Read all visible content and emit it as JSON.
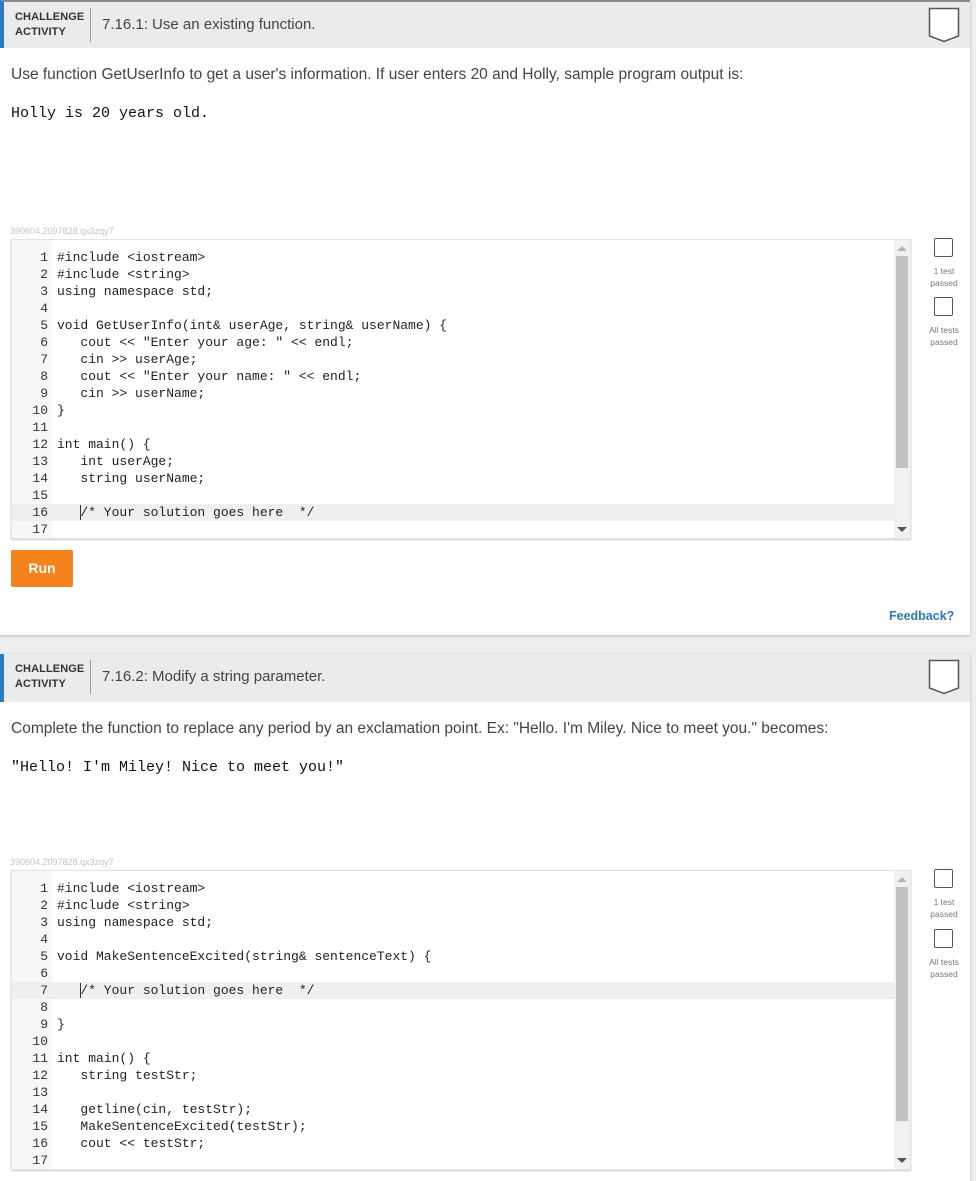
{
  "colors": {
    "accent": "#2c7bc4",
    "run": "#f4831e",
    "link": "#2a7ab8"
  },
  "icons": {
    "bookmark": "bookmark-icon",
    "test_status": "checkbox-outline-icon"
  },
  "challenges": [
    {
      "label_line1": "CHALLENGE",
      "label_line2": "ACTIVITY",
      "title": "7.16.1: Use an existing function.",
      "prompt": "Use function GetUserInfo to get a user's information. If user enters 20 and Holly, sample program output is:",
      "sample_output": "Holly is 20 years old.",
      "code_id": "390604.2097828.qx3zqy7",
      "code_lines": [
        {
          "n": "1",
          "text": "#include <iostream>"
        },
        {
          "n": "2",
          "text": "#include <string>"
        },
        {
          "n": "3",
          "text": "using namespace std;"
        },
        {
          "n": "4",
          "text": ""
        },
        {
          "n": "5",
          "text": "void GetUserInfo(int& userAge, string& userName) {"
        },
        {
          "n": "6",
          "text": "   cout << \"Enter your age: \" << endl;"
        },
        {
          "n": "7",
          "text": "   cin >> userAge;"
        },
        {
          "n": "8",
          "text": "   cout << \"Enter your name: \" << endl;"
        },
        {
          "n": "9",
          "text": "   cin >> userName;"
        },
        {
          "n": "10",
          "text": "}"
        },
        {
          "n": "11",
          "text": ""
        },
        {
          "n": "12",
          "text": "int main() {"
        },
        {
          "n": "13",
          "text": "   int userAge;"
        },
        {
          "n": "14",
          "text": "   string userName;"
        },
        {
          "n": "15",
          "text": ""
        },
        {
          "n": "16",
          "text": "   /* Your solution goes here  */"
        },
        {
          "n": "17",
          "text": ""
        }
      ],
      "tests": [
        {
          "line1": "1 test",
          "line2": "passed"
        },
        {
          "line1": "All tests",
          "line2": "passed"
        }
      ],
      "run_label": "Run",
      "feedback_label": "Feedback?"
    },
    {
      "label_line1": "CHALLENGE",
      "label_line2": "ACTIVITY",
      "title": "7.16.2: Modify a string parameter.",
      "prompt": "Complete the function to replace any period by an exclamation point. Ex: \"Hello. I'm Miley. Nice to meet you.\" becomes:",
      "sample_output": "\"Hello! I'm Miley! Nice to meet you!\"",
      "code_id": "390604.2097828.qx3zqy7",
      "code_lines": [
        {
          "n": "1",
          "text": "#include <iostream>"
        },
        {
          "n": "2",
          "text": "#include <string>"
        },
        {
          "n": "3",
          "text": "using namespace std;"
        },
        {
          "n": "4",
          "text": ""
        },
        {
          "n": "5",
          "text": "void MakeSentenceExcited(string& sentenceText) {"
        },
        {
          "n": "6",
          "text": ""
        },
        {
          "n": "7",
          "text": "   /* Your solution goes here  */"
        },
        {
          "n": "8",
          "text": ""
        },
        {
          "n": "9",
          "text": "}"
        },
        {
          "n": "10",
          "text": ""
        },
        {
          "n": "11",
          "text": "int main() {"
        },
        {
          "n": "12",
          "text": "   string testStr;"
        },
        {
          "n": "13",
          "text": ""
        },
        {
          "n": "14",
          "text": "   getline(cin, testStr);"
        },
        {
          "n": "15",
          "text": "   MakeSentenceExcited(testStr);"
        },
        {
          "n": "16",
          "text": "   cout << testStr;"
        },
        {
          "n": "17",
          "text": ""
        }
      ],
      "tests": [
        {
          "line1": "1 test",
          "line2": "passed"
        },
        {
          "line1": "All tests",
          "line2": "passed"
        }
      ]
    }
  ]
}
